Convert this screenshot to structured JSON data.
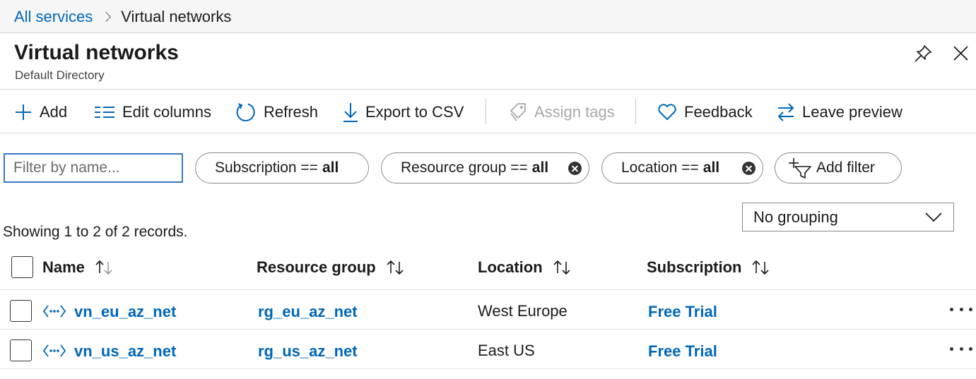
{
  "breadcrumb": {
    "parent": "All services",
    "current": "Virtual networks"
  },
  "header": {
    "title": "Virtual networks",
    "subtitle": "Default Directory"
  },
  "toolbar": {
    "add": "Add",
    "edit_columns": "Edit columns",
    "refresh": "Refresh",
    "export": "Export to CSV",
    "assign_tags": "Assign tags",
    "feedback": "Feedback",
    "leave_preview": "Leave preview"
  },
  "filters": {
    "search_placeholder": "Filter by name...",
    "subscription": {
      "label": "Subscription ==",
      "value": "all"
    },
    "resource_group": {
      "label": "Resource group ==",
      "value": "all"
    },
    "location": {
      "label": "Location ==",
      "value": "all"
    },
    "add_filter": "Add filter"
  },
  "grouping": {
    "selected": "No grouping"
  },
  "records_text": "Showing 1 to 2 of 2 records.",
  "table": {
    "columns": [
      "Name",
      "Resource group",
      "Location",
      "Subscription"
    ],
    "rows": [
      {
        "name": "vn_eu_az_net",
        "resource_group": "rg_eu_az_net",
        "location": "West Europe",
        "subscription": "Free Trial"
      },
      {
        "name": "vn_us_az_net",
        "resource_group": "rg_us_az_net",
        "location": "East US",
        "subscription": "Free Trial"
      }
    ]
  },
  "colors": {
    "link": "#0067b8",
    "focus_border": "#3a78c6",
    "disabled": "#a8a8a8"
  },
  "icons": [
    "chevron-right-icon",
    "pin-icon",
    "close-icon",
    "plus-icon",
    "columns-icon",
    "refresh-icon",
    "download-icon",
    "tag-icon",
    "heart-icon",
    "swap-icon",
    "filter-add-icon",
    "chevron-down-icon",
    "sort-icon",
    "virtual-network-icon",
    "more-icon"
  ]
}
